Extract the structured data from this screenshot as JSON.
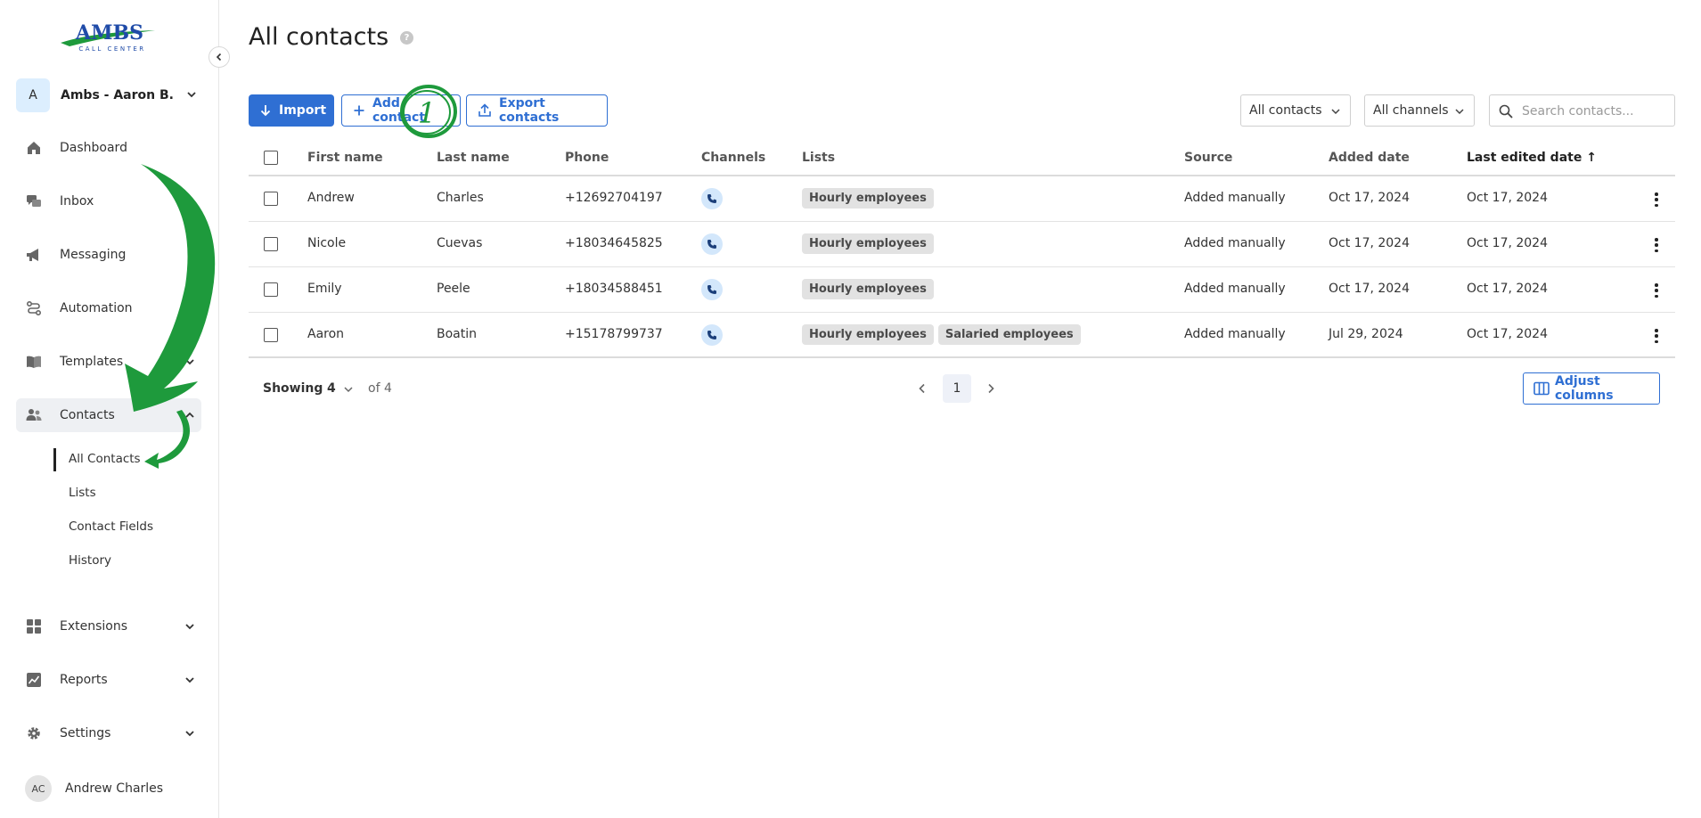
{
  "sidebar": {
    "logo_text": "AMBS",
    "logo_subtext": "CALL CENTER",
    "workspace": {
      "initial": "A",
      "name": "Ambs - Aaron B..."
    },
    "nav": [
      {
        "label": "Dashboard",
        "icon": "home-icon"
      },
      {
        "label": "Inbox",
        "icon": "chat-icon"
      },
      {
        "label": "Messaging",
        "icon": "megaphone-icon"
      },
      {
        "label": "Automation",
        "icon": "route-icon"
      },
      {
        "label": "Templates",
        "icon": "book-icon"
      },
      {
        "label": "Contacts",
        "icon": "people-icon"
      },
      {
        "label": "Extensions",
        "icon": "grid-icon"
      },
      {
        "label": "Reports",
        "icon": "chart-icon"
      },
      {
        "label": "Settings",
        "icon": "gear-icon"
      }
    ],
    "contacts_sub": [
      "All Contacts",
      "Lists",
      "Contact Fields",
      "History"
    ],
    "user": {
      "initials": "AC",
      "name": "Andrew Charles"
    }
  },
  "header": {
    "title": "All contacts",
    "help": "?"
  },
  "toolbar": {
    "import_label": "Import",
    "add_label": "Add contact",
    "export_label": "Export contacts",
    "filter_contacts": "All contacts",
    "filter_channels": "All channels",
    "search_placeholder": "Search contacts..."
  },
  "table": {
    "columns": [
      "First name",
      "Last name",
      "Phone",
      "Channels",
      "Lists",
      "Source",
      "Added date",
      "Last edited date ↑"
    ],
    "rows": [
      {
        "first": "Andrew",
        "last": "Charles",
        "phone": "+12692704197",
        "lists": [
          "Hourly employees"
        ],
        "source": "Added manually",
        "added": "Oct 17, 2024",
        "edited": "Oct 17, 2024"
      },
      {
        "first": "Nicole",
        "last": "Cuevas",
        "phone": "+18034645825",
        "lists": [
          "Hourly employees"
        ],
        "source": "Added manually",
        "added": "Oct 17, 2024",
        "edited": "Oct 17, 2024"
      },
      {
        "first": "Emily",
        "last": "Peele",
        "phone": "+18034588451",
        "lists": [
          "Hourly employees"
        ],
        "source": "Added manually",
        "added": "Oct 17, 2024",
        "edited": "Oct 17, 2024"
      },
      {
        "first": "Aaron",
        "last": "Boatin",
        "phone": "+15178799737",
        "lists": [
          "Hourly employees",
          "Salaried employees"
        ],
        "source": "Added manually",
        "added": "Jul 29, 2024",
        "edited": "Oct 17, 2024"
      }
    ]
  },
  "footer": {
    "showing_label": "Showing",
    "page_size": "4",
    "of_label": "of 4",
    "current_page": "1",
    "adjust_label": "Adjust columns"
  },
  "annotation": {
    "step_number": "1",
    "color": "#1e9a3c"
  },
  "colors": {
    "primary": "#2f6fd3",
    "tag_bg": "#e2e2e2",
    "channel_bg": "#d3e7fb"
  }
}
